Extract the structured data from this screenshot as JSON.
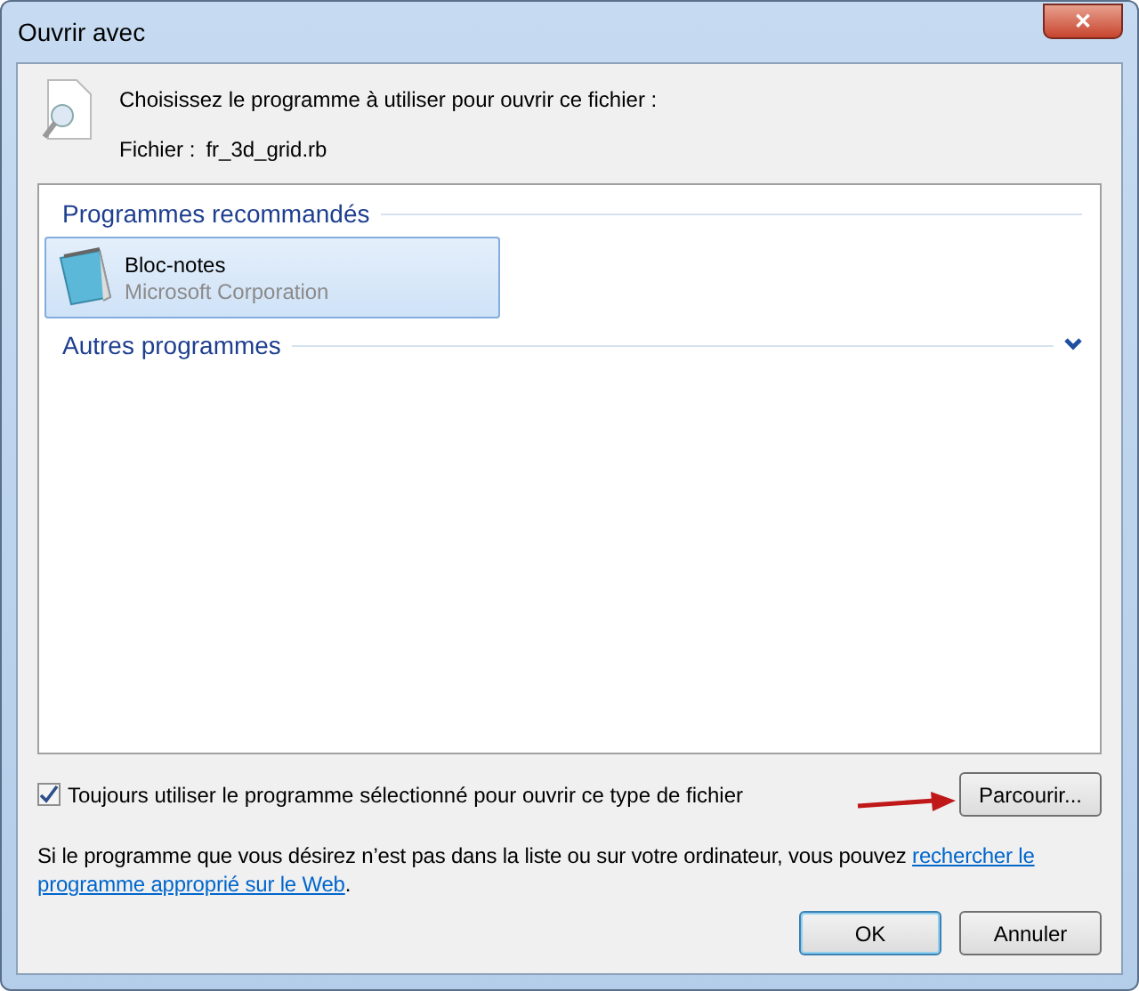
{
  "window": {
    "title": "Ouvrir avec",
    "close": "✕"
  },
  "header": {
    "prompt": "Choisissez le programme à utiliser pour ouvrir ce fichier :",
    "file_label": "Fichier :",
    "file_name": "fr_3d_grid.rb"
  },
  "groups": [
    {
      "title": "Programmes recommandés",
      "expander": false,
      "programs": [
        {
          "name": "Bloc-notes",
          "publisher": "Microsoft Corporation",
          "selected": true
        }
      ]
    },
    {
      "title": "Autres programmes",
      "expander": true
    }
  ],
  "always_use": {
    "label": "Toujours utiliser le programme sélectionné pour ouvrir ce type de fichier",
    "checked": true
  },
  "browse_button": "Parcourir...",
  "note": {
    "text": "Si le programme que vous désirez n’est pas dans la liste ou sur votre ordinateur, vous pouvez ",
    "link_lines": [
      "rechercher le",
      "programme approprié sur le Web"
    ],
    "end": "."
  },
  "buttons": [
    {
      "label": "OK",
      "default": true
    },
    {
      "label": "Annuler",
      "default": false
    }
  ]
}
